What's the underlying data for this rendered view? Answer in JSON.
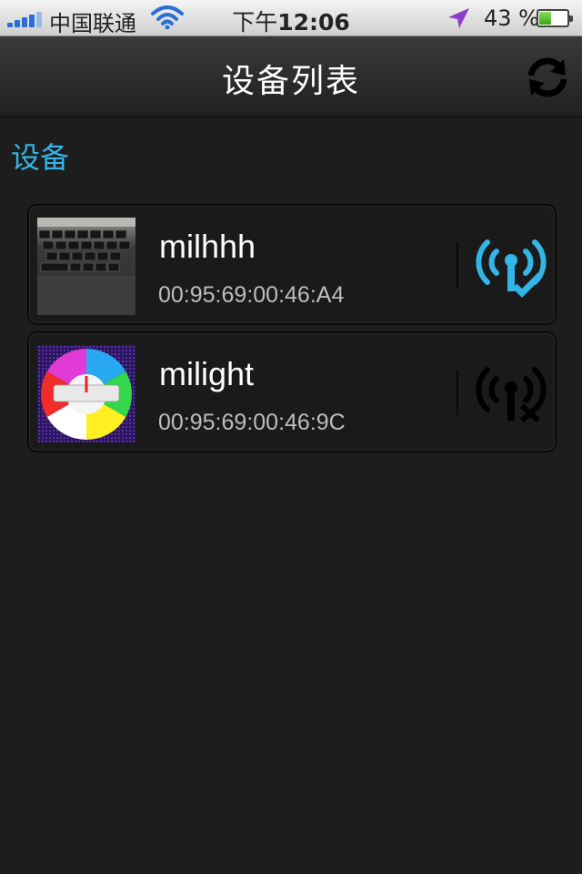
{
  "status_bar": {
    "carrier": "中国联通",
    "time_prefix": "下午",
    "time": "12:06",
    "battery_pct": "43 %",
    "battery_level": 0.43
  },
  "nav": {
    "title": "设备列表",
    "refresh_icon": "refresh-icon"
  },
  "section": {
    "label": "设备"
  },
  "devices": [
    {
      "name": "milhhh",
      "mac": "00:95:69:00:46:A4",
      "thumbnail": "keyboard-photo",
      "status": "connected",
      "status_icon": "wireless-connected-icon",
      "status_color": "#33b5e5"
    },
    {
      "name": "milight",
      "mac": "00:95:69:00:46:9C",
      "thumbnail": "milight-color-wheel",
      "status": "disconnected",
      "status_icon": "wireless-disconnected-icon",
      "status_color": "#000000"
    }
  ],
  "colors": {
    "accent": "#33b5e5",
    "background": "#1d1d1e"
  }
}
